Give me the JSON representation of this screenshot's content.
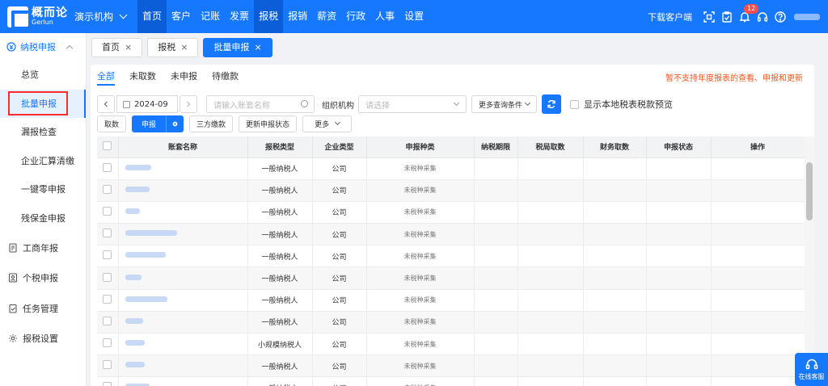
{
  "brand": {
    "name_cn": "概而论",
    "name_en": "Gerlun"
  },
  "org_name": "演示机构",
  "nav": [
    "首页",
    "客户",
    "记账",
    "发票",
    "报税",
    "报销",
    "薪资",
    "行政",
    "人事",
    "设置"
  ],
  "topbar": {
    "download": "下载客户端",
    "badge_count": "12"
  },
  "sidebar": {
    "section": "纳税申报",
    "sub_items": [
      "总览",
      "批量申报",
      "漏报检查",
      "企业汇算清缴",
      "一键零申报",
      "残保金申报"
    ],
    "main_items": [
      "工商年报",
      "个税申报",
      "任务管理",
      "报税设置"
    ]
  },
  "tabs": [
    "首页",
    "报税",
    "批量申报"
  ],
  "subtabs": [
    "全部",
    "未取数",
    "未申报",
    "待缴款"
  ],
  "notice": "暂不支持年度报表的查看、申报和更新",
  "filters": {
    "period": "2024-09",
    "search_placeholder": "请输入账套名称",
    "org_label": "组织机构",
    "org_placeholder": "请选择",
    "more_conditions": "更多查询条件",
    "local_preview_label": "显示本地税表税款预览"
  },
  "actions": {
    "fetch": "取数",
    "declare": "申报",
    "third_party_pay": "三方缴款",
    "update_status": "更新申报状态",
    "more": "更多"
  },
  "table": {
    "columns": [
      "账套名称",
      "报税类型",
      "企业类型",
      "申报种类",
      "纳税期限",
      "税局取数",
      "财务取数",
      "申报状态",
      "操作"
    ],
    "rows": [
      {
        "tax_type": "一般纳税人",
        "company_type": "公司",
        "category": "未税种采集"
      },
      {
        "tax_type": "一般纳税人",
        "company_type": "公司",
        "category": "未税种采集"
      },
      {
        "tax_type": "一般纳税人",
        "company_type": "公司",
        "category": "未税种采集"
      },
      {
        "tax_type": "一般纳税人",
        "company_type": "公司",
        "category": "未税种采集"
      },
      {
        "tax_type": "一般纳税人",
        "company_type": "公司",
        "category": "未税种采集"
      },
      {
        "tax_type": "一般纳税人",
        "company_type": "公司",
        "category": "未税种采集"
      },
      {
        "tax_type": "一般纳税人",
        "company_type": "公司",
        "category": "未税种采集"
      },
      {
        "tax_type": "一般纳税人",
        "company_type": "公司",
        "category": "未税种采集"
      },
      {
        "tax_type": "小规模纳税人",
        "company_type": "公司",
        "category": "未税种采集"
      },
      {
        "tax_type": "一般纳税人",
        "company_type": "公司",
        "category": "未税种采集"
      },
      {
        "tax_type": "一般纳税人",
        "company_type": "公司",
        "category": "未税种采集"
      }
    ]
  },
  "service_label": "在线客服"
}
